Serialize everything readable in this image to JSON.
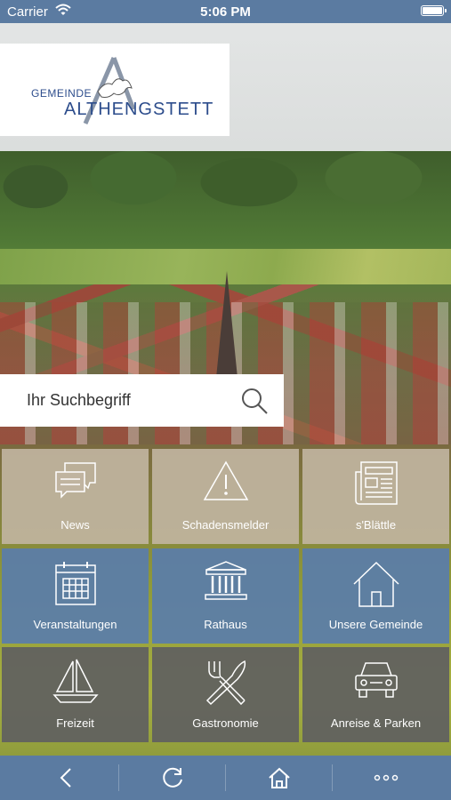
{
  "status_bar": {
    "carrier": "Carrier",
    "time": "5:06 PM"
  },
  "logo": {
    "line1": "GEMEINDE",
    "line2": "ALTHENGSTETT"
  },
  "search": {
    "placeholder": "Ihr Suchbegriff"
  },
  "tiles": [
    {
      "label": "News",
      "icon": "chat-bubbles-icon"
    },
    {
      "label": "Schadensmelder",
      "icon": "warning-icon"
    },
    {
      "label": "s'Blättle",
      "icon": "newspaper-icon"
    },
    {
      "label": "Veranstaltungen",
      "icon": "calendar-icon"
    },
    {
      "label": "Rathaus",
      "icon": "town-hall-icon"
    },
    {
      "label": "Unsere Gemeinde",
      "icon": "house-icon"
    },
    {
      "label": "Freizeit",
      "icon": "sailboat-icon"
    },
    {
      "label": "Gastronomie",
      "icon": "fork-knife-icon"
    },
    {
      "label": "Anreise & Parken",
      "icon": "car-icon"
    }
  ],
  "bottom_bar": [
    "back-icon",
    "reload-icon",
    "home-icon",
    "more-icon"
  ],
  "colors": {
    "bar": "#5b7ba1",
    "tile_beige": "#c0b4a0",
    "tile_blue": "#5a7daa",
    "tile_gray": "#606060"
  }
}
